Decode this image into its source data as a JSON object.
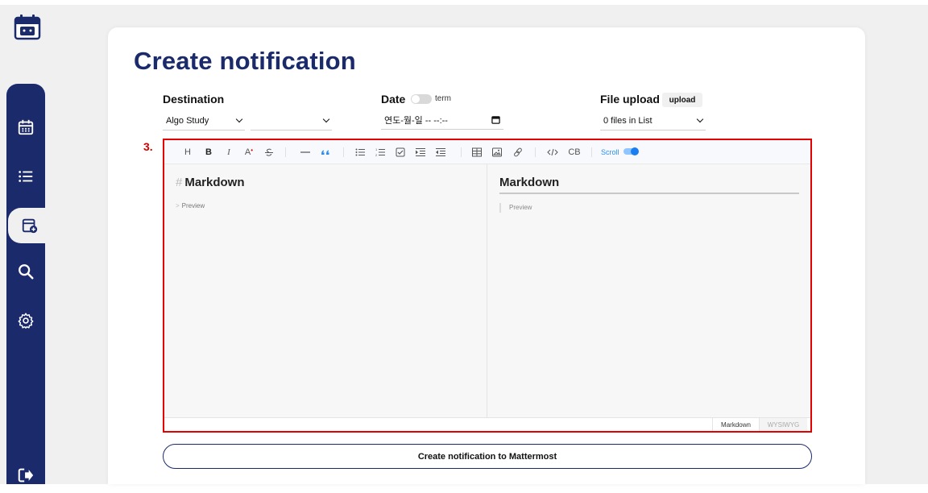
{
  "page": {
    "title": "Create notification"
  },
  "sidebar": {
    "items": [
      {
        "name": "calendar"
      },
      {
        "name": "list"
      },
      {
        "name": "create"
      },
      {
        "name": "search"
      },
      {
        "name": "settings"
      }
    ],
    "logout": "logout"
  },
  "form": {
    "destination_label": "Destination",
    "destination_value": "Algo Study",
    "destination_sub_value": "",
    "date_label": "Date",
    "date_toggle_label": "term",
    "date_value": "연도-월-일 -- --:--",
    "file_label": "File upload",
    "upload_button": "upload",
    "file_value": "0 files in List"
  },
  "step_label": "3.",
  "editor": {
    "toolbar": {
      "heading": "H",
      "bold": "B",
      "italic": "I",
      "text_color": "A",
      "codeblock": "CB",
      "scroll_label": "Scroll"
    },
    "markdown_heading": "Markdown",
    "markdown_quote": "Preview",
    "preview_heading": "Markdown",
    "preview_quote": "Preview",
    "tabs": [
      "Markdown",
      "WYSIWYG"
    ]
  },
  "submit_button": "Create notification to Mattermost",
  "colors": {
    "navy": "#1b2a6b",
    "highlight": "#e20000",
    "accent": "#1a7ff0"
  }
}
